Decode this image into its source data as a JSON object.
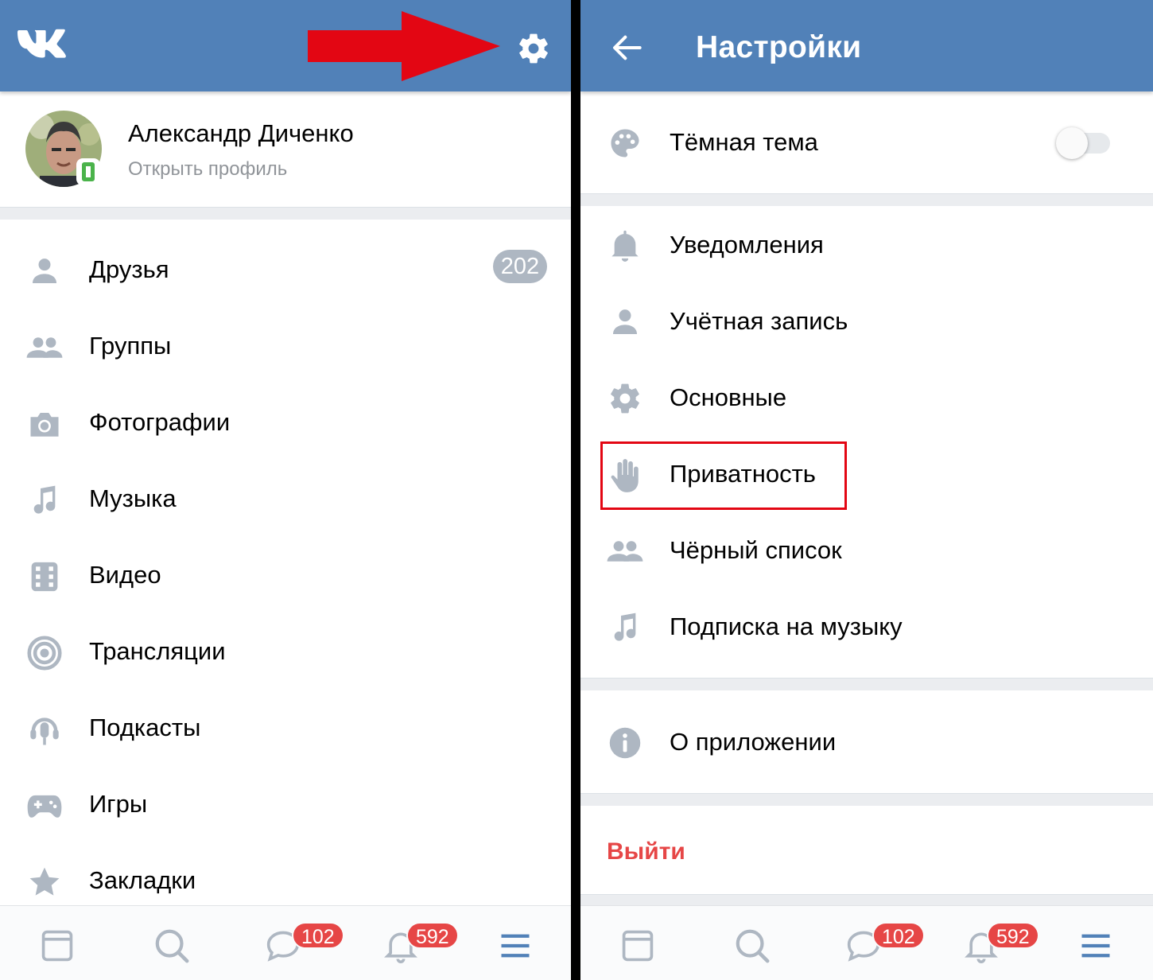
{
  "colors": {
    "brand": "#5181b8",
    "icon": "#aeb7c2",
    "badge": "#e64646",
    "annotation": "#e30613"
  },
  "left": {
    "header": {
      "logo_icon": "vk-logo-icon",
      "settings_icon": "gear-icon"
    },
    "profile": {
      "name": "Александр Диченко",
      "subtitle": "Открыть профиль"
    },
    "menu": [
      {
        "label": "Друзья",
        "icon": "person-icon",
        "badge": "202"
      },
      {
        "label": "Группы",
        "icon": "people-icon"
      },
      {
        "label": "Фотографии",
        "icon": "camera-icon"
      },
      {
        "label": "Музыка",
        "icon": "music-note-icon"
      },
      {
        "label": "Видео",
        "icon": "film-icon"
      },
      {
        "label": "Трансляции",
        "icon": "broadcast-icon"
      },
      {
        "label": "Подкасты",
        "icon": "podcast-icon"
      },
      {
        "label": "Игры",
        "icon": "gamepad-icon"
      },
      {
        "label": "Закладки",
        "icon": "star-icon"
      }
    ]
  },
  "right": {
    "header": {
      "title": "Настройки",
      "back_icon": "arrow-left-icon"
    },
    "dark_theme": {
      "label": "Тёмная тема",
      "enabled": false
    },
    "items": [
      {
        "label": "Уведомления",
        "icon": "bell-icon"
      },
      {
        "label": "Учётная запись",
        "icon": "person-icon"
      },
      {
        "label": "Основные",
        "icon": "gear-icon"
      },
      {
        "label": "Приватность",
        "icon": "hand-icon",
        "highlighted": true
      },
      {
        "label": "Чёрный список",
        "icon": "people-icon"
      },
      {
        "label": "Подписка на музыку",
        "icon": "music-note-icon"
      }
    ],
    "about": {
      "label": "О приложении",
      "icon": "info-icon"
    },
    "logout": {
      "label": "Выйти"
    }
  },
  "bottom_nav": {
    "tabs": [
      "news-icon",
      "search-icon",
      "messages-icon",
      "notifications-icon",
      "menu-icon"
    ],
    "messages_badge": "102",
    "notifications_badge": "592"
  }
}
